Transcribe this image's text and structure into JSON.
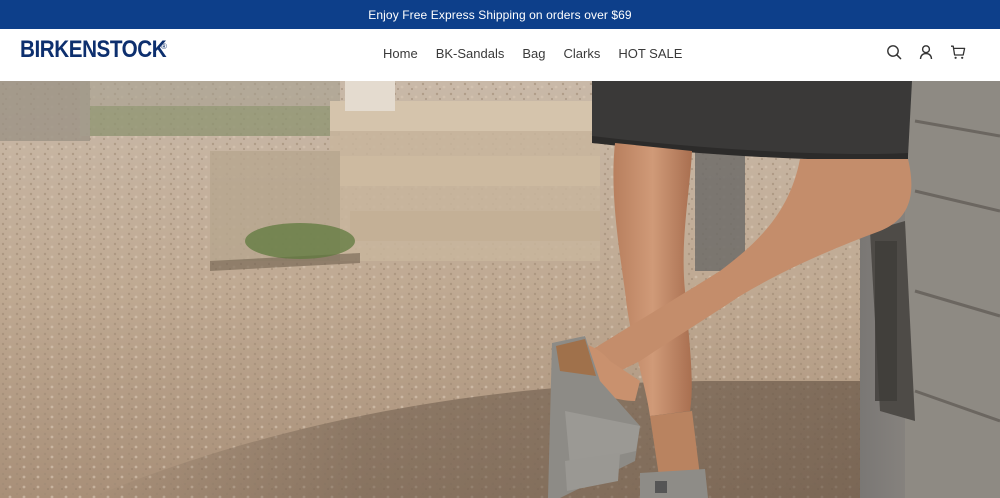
{
  "announcement": {
    "text": "Enjoy Free Express Shipping on orders over $69"
  },
  "header": {
    "logo_text": "BIRKENSTOCK",
    "logo_mark": "®",
    "nav": [
      {
        "label": "Home"
      },
      {
        "label": "BK-Sandals"
      },
      {
        "label": "Bag"
      },
      {
        "label": "Clarks"
      },
      {
        "label": "HOT SALE"
      }
    ],
    "icons": [
      "search-icon",
      "account-icon",
      "cart-icon"
    ]
  },
  "colors": {
    "announcement_bg": "#0d3f8a",
    "logo": "#0d2f6e",
    "nav_text": "#3a3a3a"
  }
}
